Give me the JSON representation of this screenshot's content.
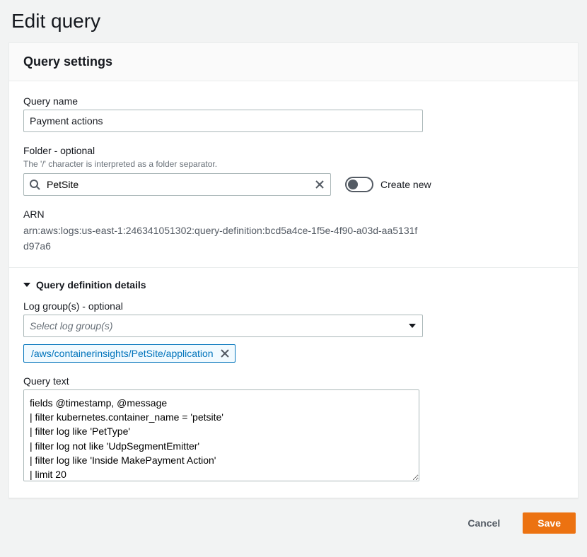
{
  "page": {
    "title": "Edit query"
  },
  "settings": {
    "header": "Query settings",
    "query_name": {
      "label": "Query name",
      "value": "Payment actions"
    },
    "folder": {
      "label": "Folder - optional",
      "hint": "The '/' character is interpreted as a folder separator.",
      "value": "PetSite",
      "create_new_label": "Create new",
      "create_new_on": false
    },
    "arn": {
      "label": "ARN",
      "value": "arn:aws:logs:us-east-1:246341051302:query-definition:bcd5a4ce-1f5e-4f90-a03d-aa5131fd97a6"
    }
  },
  "details": {
    "header": "Query definition details",
    "log_groups": {
      "label": "Log group(s) - optional",
      "placeholder": "Select log group(s)",
      "selected": [
        "/aws/containerinsights/PetSite/application"
      ]
    },
    "query_text": {
      "label": "Query text",
      "value": "fields @timestamp, @message\n| filter kubernetes.container_name = 'petsite'\n| filter log like 'PetType'\n| filter log not like 'UdpSegmentEmitter'\n| filter log like 'Inside MakePayment Action'\n| limit 20"
    }
  },
  "actions": {
    "cancel": "Cancel",
    "save": "Save"
  }
}
